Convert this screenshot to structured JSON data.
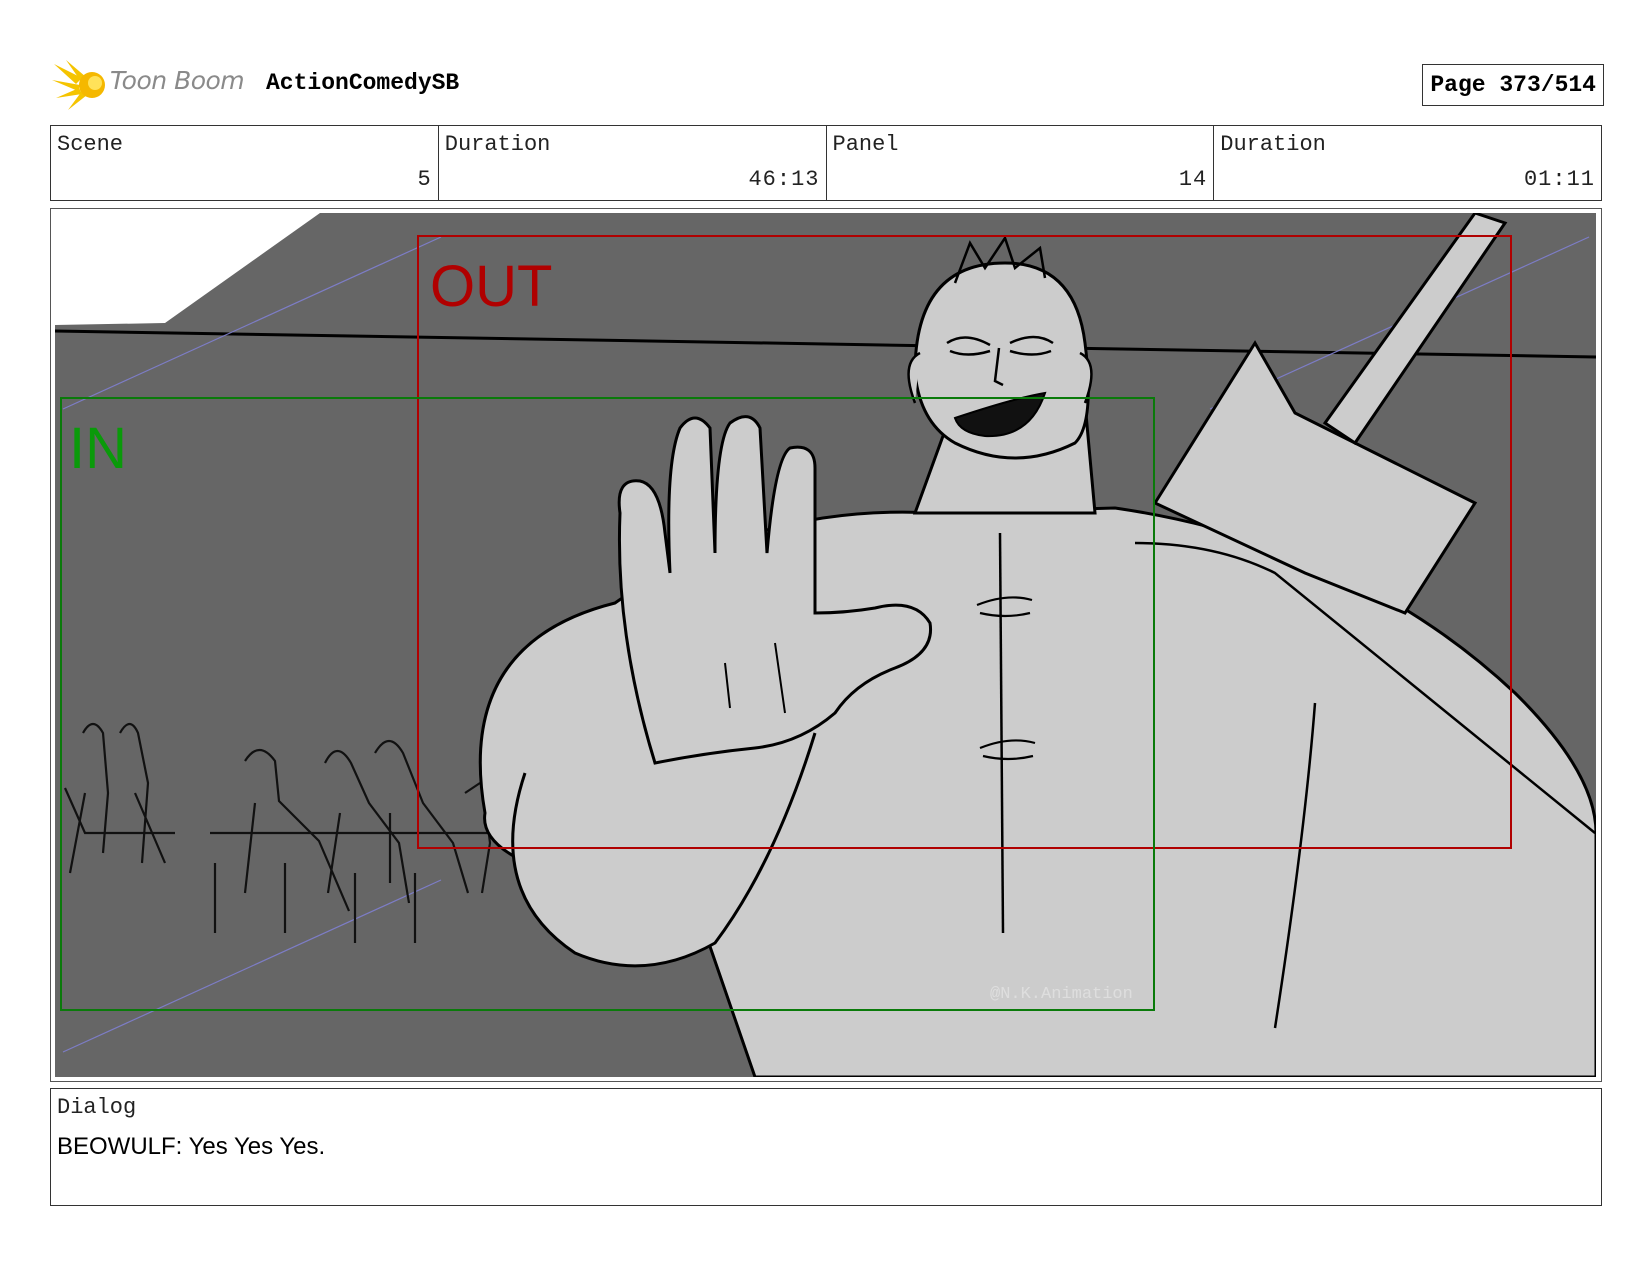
{
  "header": {
    "brand": "Toon Boom",
    "project": "ActionComedySB",
    "page": "Page 373/514"
  },
  "info": {
    "scene_label": "Scene",
    "scene_value": "5",
    "scene_duration_label": "Duration",
    "scene_duration_value": "46:13",
    "panel_label": "Panel",
    "panel_value": "14",
    "panel_duration_label": "Duration",
    "panel_duration_value": "01:11"
  },
  "frame": {
    "out_label": "OUT",
    "in_label": "IN",
    "watermark": "@N.K.Animation",
    "out_color": "#b00000",
    "in_color": "#0a9a0a"
  },
  "dialog": {
    "label": "Dialog",
    "text": "BEOWULF: Yes Yes Yes."
  },
  "icons": {
    "logo": "toon-boom-sun-icon"
  }
}
